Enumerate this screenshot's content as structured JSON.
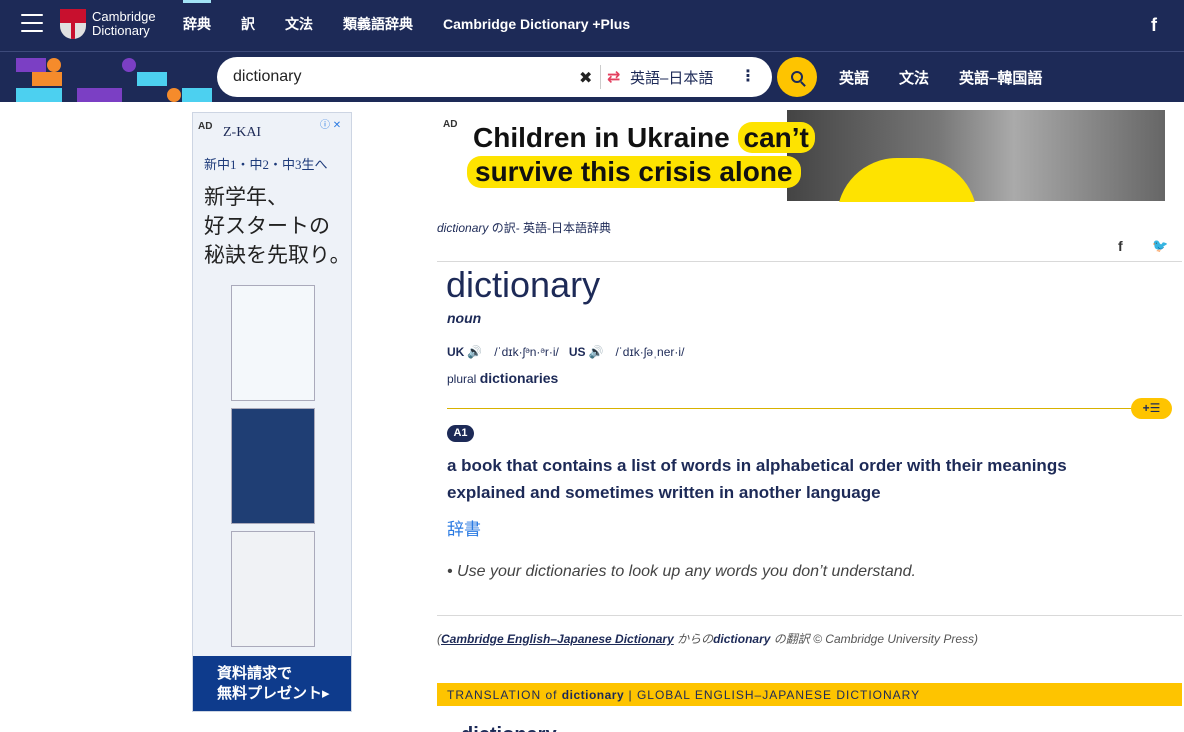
{
  "topnav": {
    "logo_line1": "Cambridge",
    "logo_line2": "Dictionary",
    "links": [
      "辞典",
      "訳",
      "文法",
      "類義語辞典",
      "Cambridge Dictionary +Plus"
    ],
    "facebook": "f"
  },
  "search": {
    "value": "dictionary",
    "clear": "✖",
    "swap_icon": "⇄",
    "language": "英語–日本語",
    "more": "⋮",
    "quick_links": [
      "英語",
      "文法",
      "英語–韓国語"
    ]
  },
  "ad_left": {
    "tag": "AD",
    "brand": "Z-KAI",
    "info": "ⓘ ✕",
    "line1": "新中1・中2・中3生へ",
    "head1": "新学年、",
    "head2": "好スタートの",
    "head3": "秘訣を先取り。",
    "cta1": "資料請求で",
    "cta2": "無料プレゼント▸"
  },
  "ad_top": {
    "tag": "AD",
    "line1_a": "Children in Ukraine",
    "line1_b": "can’t",
    "line2": "survive this crisis alone"
  },
  "breadcrumb": {
    "word": "dictionary",
    "rest": " の訳- 英語-日本語辞典"
  },
  "share": {
    "facebook": "f",
    "twitter": "🐦"
  },
  "entry": {
    "headword": "dictionary",
    "pos": "noun",
    "uk_label": "UK",
    "uk_ipa": "/ˈdɪk·ʃᵊn·ᵊr·i/",
    "us_label": "US",
    "us_ipa": "/ˈdɪk·ʃəˌner·i/",
    "speaker": "🔊",
    "plural_label": "plural",
    "plural_value": "dictionaries",
    "add_list": "+☰",
    "level": "A1",
    "definition": "a book that contains a list of words in alphabetical order with their meanings explained and sometimes written in another language",
    "translation": "辞書",
    "example": "• Use your dictionaries to look up any words you don’t understand."
  },
  "credit": {
    "open": "(",
    "source": "Cambridge English–Japanese Dictionary",
    "mid": " からの",
    "word": "dictionary",
    "end": " の翻訳 © Cambridge University Press)"
  },
  "banner": {
    "prefix": "TRANSLATION of ",
    "word": "dictionary",
    "suffix": " | GLOBAL ENGLISH–JAPANESE DICTIONARY"
  },
  "next_heading": "dictionary",
  "colors": {
    "navy": "#1d2a57",
    "gold": "#fec400",
    "link": "#2a7ae2"
  }
}
